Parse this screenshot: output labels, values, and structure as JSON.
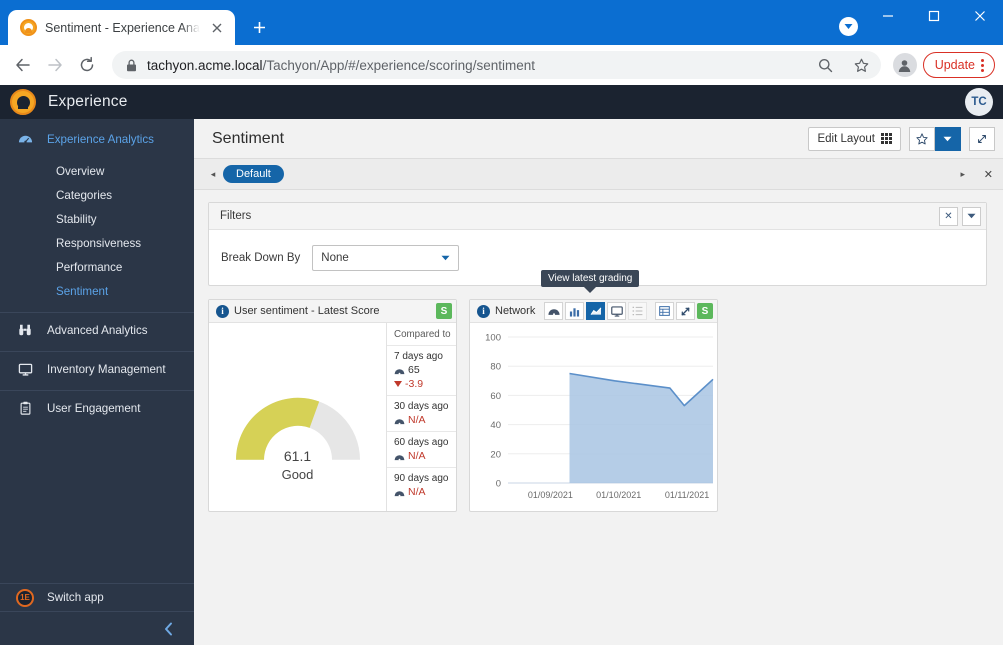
{
  "browser": {
    "tab": {
      "title": "Sentiment - Experience Analytics",
      "favicon": "user-circle-icon",
      "close": "✕"
    },
    "newtab_label": "+",
    "window": {
      "minimize": "─",
      "maximize": "□",
      "close": "✕",
      "caret": "▼"
    },
    "nav": {
      "back": "←",
      "forward": "→",
      "reload": "↻"
    },
    "omnibox": {
      "lock": "lock-icon",
      "url_host": "tachyon.acme.local",
      "url_path": "/Tachyon/App/#/experience/scoring/sentiment",
      "search_icon": "⌕",
      "bookmark_icon": "☆"
    },
    "update_label": "Update",
    "profile_icon": "person-icon"
  },
  "app": {
    "logo": "experience-logo",
    "title": "Experience",
    "avatar": "TC"
  },
  "sidebar": {
    "items": [
      {
        "label": "Experience Analytics",
        "icon": "gauge-icon",
        "active": true
      },
      {
        "label": "Advanced Analytics",
        "icon": "binoculars-icon",
        "active": false
      },
      {
        "label": "Inventory Management",
        "icon": "monitor-icon",
        "active": false
      },
      {
        "label": "User Engagement",
        "icon": "clipboard-icon",
        "active": false
      }
    ],
    "sub_items": [
      {
        "label": "Overview",
        "active": false
      },
      {
        "label": "Categories",
        "active": false
      },
      {
        "label": "Stability",
        "active": false
      },
      {
        "label": "Responsiveness",
        "active": false
      },
      {
        "label": "Performance",
        "active": false
      },
      {
        "label": "Sentiment",
        "active": true
      }
    ],
    "switch_app": {
      "label": "Switch app",
      "icon": "switch-app-icon",
      "badge": "1E"
    },
    "collapse": "‹"
  },
  "page": {
    "title": "Sentiment",
    "edit_layout": "Edit Layout",
    "star_icon": "☆",
    "caret_icon": "▼",
    "expand_icon": "⤡",
    "tabs": {
      "prev": "◂",
      "next": "▸",
      "close": "✕",
      "items": [
        {
          "label": "Default",
          "active": true
        }
      ]
    }
  },
  "filters": {
    "title": "Filters",
    "close_icon": "✕",
    "collapse_icon": "▼",
    "break_down_by": {
      "label": "Break Down By",
      "value": "None",
      "caret": "▼"
    }
  },
  "tooltip": {
    "text": "View latest grading"
  },
  "widget_gauge": {
    "title": "User sentiment - Latest Score",
    "info_icon": "i",
    "badge": "S",
    "score": "61.1",
    "score_label": "Good",
    "score_value": 61.1,
    "arc_color": "#d6d156",
    "track_color": "#e6e6e6",
    "compared_to_header": "Compared to",
    "rows": [
      {
        "when": "7 days ago",
        "value": "65",
        "na": false,
        "delta": "-3.9",
        "delta_dir": "down"
      },
      {
        "when": "30 days ago",
        "value": "N/A",
        "na": true,
        "delta": null,
        "delta_dir": null
      },
      {
        "when": "60 days ago",
        "value": "N/A",
        "na": true,
        "delta": null,
        "delta_dir": null
      },
      {
        "when": "90 days ago",
        "value": "N/A",
        "na": true,
        "delta": null,
        "delta_dir": null
      }
    ]
  },
  "widget_chart": {
    "title": "Network P",
    "info_icon": "i",
    "badge": "S",
    "tools": [
      {
        "name": "gauge-view-icon",
        "selected": false,
        "faint": false
      },
      {
        "name": "bar-chart-view-icon",
        "selected": false,
        "faint": false
      },
      {
        "name": "area-chart-view-icon",
        "selected": true,
        "faint": false
      },
      {
        "name": "monitor-view-icon",
        "selected": false,
        "faint": false
      },
      {
        "name": "list-view-icon",
        "selected": false,
        "faint": true
      },
      {
        "name": "table-view-icon",
        "selected": false,
        "faint": false
      },
      {
        "name": "expand-icon",
        "selected": false,
        "faint": false
      }
    ]
  },
  "chart_data": {
    "type": "area",
    "title": "Network P",
    "xlabel": "",
    "ylabel": "",
    "ylim": [
      0,
      100
    ],
    "yticks": [
      0,
      20,
      40,
      60,
      80,
      100
    ],
    "xticks": [
      "01/09/2021",
      "01/10/2021",
      "01/11/2021"
    ],
    "grid": true,
    "legend": "none",
    "line_color": "#5b8fc9",
    "fill_color": "#a8c4e3",
    "x": [
      "01/09/2021",
      "01/10/2021",
      "01/11/2021",
      "01/11/2021+",
      "01/11/2021++"
    ],
    "series": [
      {
        "name": "Network P",
        "values": [
          75,
          70,
          65,
          53,
          71
        ]
      }
    ],
    "points": [
      {
        "x": 0.3,
        "y": 75
      },
      {
        "x": 0.52,
        "y": 70
      },
      {
        "x": 0.79,
        "y": 65
      },
      {
        "x": 0.86,
        "y": 53
      },
      {
        "x": 1.0,
        "y": 71
      }
    ]
  }
}
